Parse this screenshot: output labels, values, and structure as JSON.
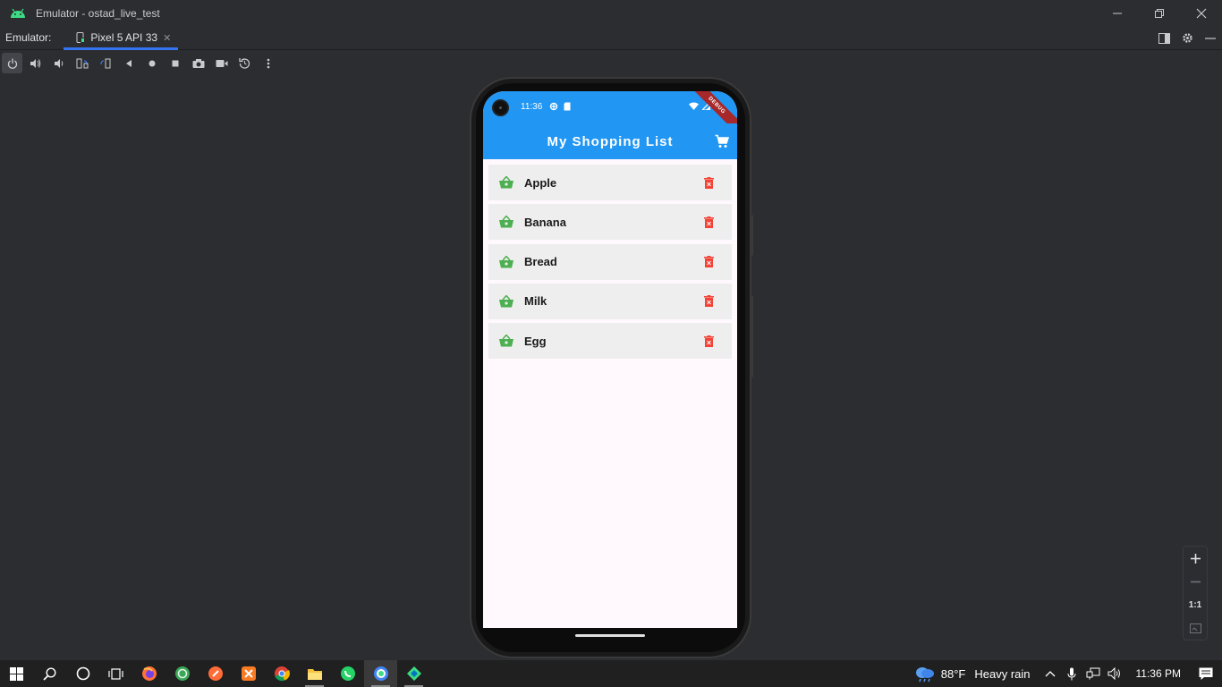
{
  "window": {
    "title": "Emulator - ostad_live_test"
  },
  "tabbar": {
    "label": "Emulator:",
    "tab_name": "Pixel 5 API 33"
  },
  "device": {
    "status_time": "11:36",
    "debug_label": "DEBUG",
    "app_title": "My Shopping List",
    "items": [
      {
        "label": "Apple"
      },
      {
        "label": "Banana"
      },
      {
        "label": "Bread"
      },
      {
        "label": "Milk"
      },
      {
        "label": "Egg"
      }
    ],
    "colors": {
      "appbar": "#2196f3",
      "item_icon": "#4caf50",
      "delete_icon": "#f44336"
    }
  },
  "zoom": {
    "one_to_one": "1:1"
  },
  "taskbar": {
    "weather_temp": "88°F",
    "weather_desc": "Heavy rain",
    "clock": "11:36 PM"
  }
}
